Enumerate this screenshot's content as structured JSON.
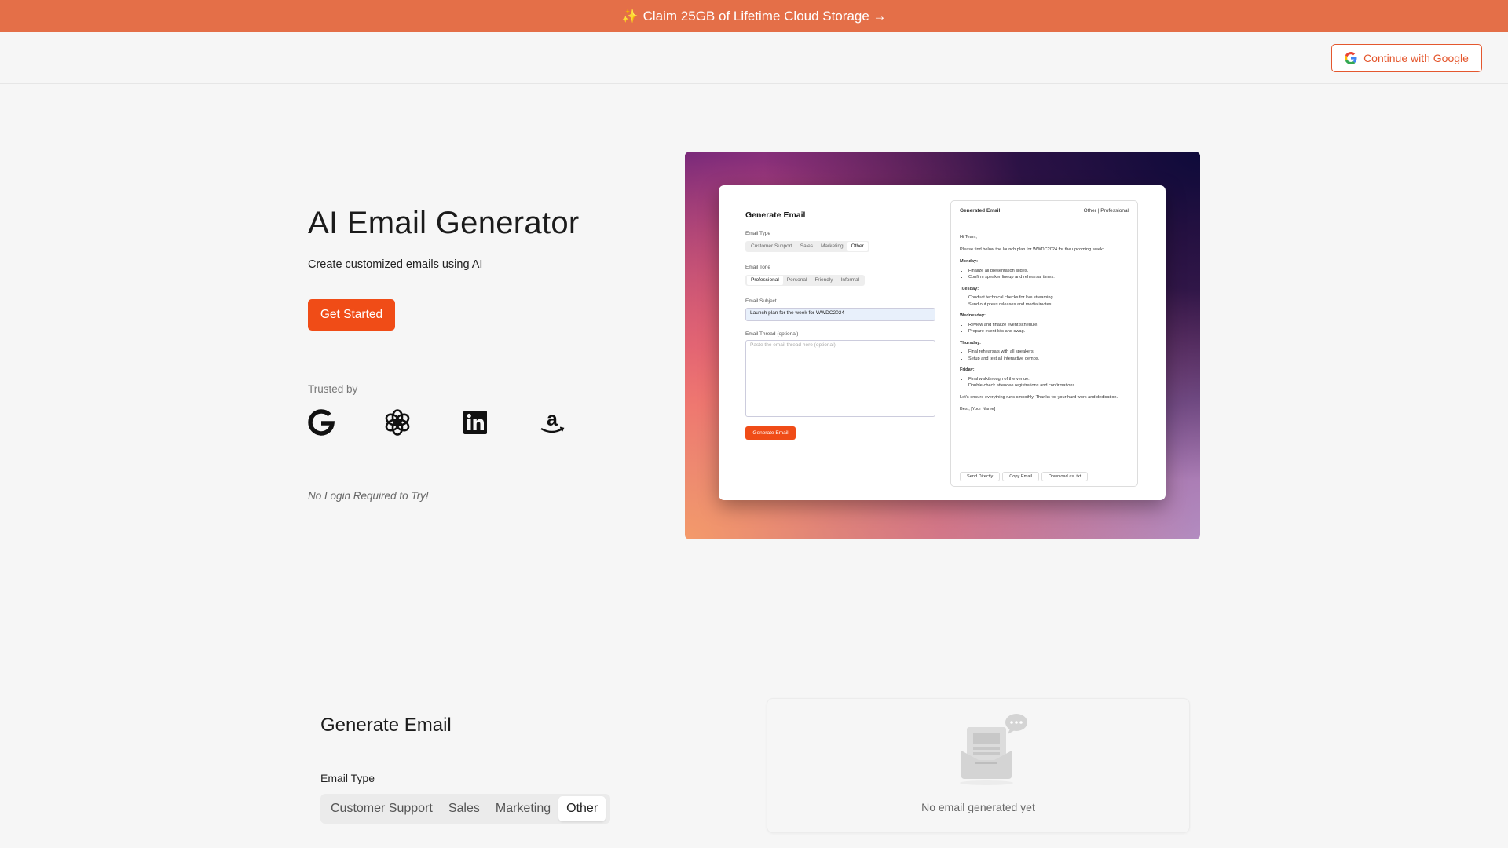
{
  "banner": {
    "text": "Claim 25GB of Lifetime Cloud Storage →",
    "icon": "sparkle-icon"
  },
  "header": {
    "google_button": "Continue with Google"
  },
  "hero": {
    "title": "AI Email Generator",
    "subtitle": "Create customized emails using AI",
    "cta": "Get Started",
    "trusted_by": "Trusted by",
    "logos": [
      "google-logo",
      "openai-logo",
      "linkedin-logo",
      "amazon-logo"
    ],
    "note": "No Login Required to Try!"
  },
  "preview": {
    "title": "Generate Email",
    "email_type_label": "Email Type",
    "email_types": [
      "Customer Support",
      "Sales",
      "Marketing",
      "Other"
    ],
    "email_tone_label": "Email Tone",
    "tones": [
      "Professional",
      "Personal",
      "Friendly",
      "Informal"
    ],
    "subject_label": "Email Subject",
    "subject_value": "Launch plan for the week for WWDC2024",
    "thread_label": "Email Thread (optional)",
    "thread_placeholder": "Paste the email thread here (optional)",
    "generate_button": "Generate Email",
    "output_title": "Generated Email",
    "output_meta": "Other | Professional",
    "greeting": "Hi Team,",
    "intro": "Please find below the launch plan for WWDC2024 for the upcoming week:",
    "days": [
      {
        "name": "Monday:",
        "items": [
          "Finalize all presentation slides.",
          "Confirm speaker lineup and rehearsal times."
        ]
      },
      {
        "name": "Tuesday:",
        "items": [
          "Conduct technical checks for live streaming.",
          "Send out press releases and media invites."
        ]
      },
      {
        "name": "Wednesday:",
        "items": [
          "Review and finalize event schedule.",
          "Prepare event kits and swag."
        ]
      },
      {
        "name": "Thursday:",
        "items": [
          "Final rehearsals with all speakers.",
          "Setup and test all interactive demos."
        ]
      },
      {
        "name": "Friday:",
        "items": [
          "Final walkthrough of the venue.",
          "Double-check attendee registrations and confirmations."
        ]
      }
    ],
    "closing": "Let's ensure everything runs smoothly. Thanks for your hard work and dedication.",
    "signoff": "Best, [Your Name]",
    "actions": [
      "Send Directly",
      "Copy Email",
      "Download as .txt"
    ]
  },
  "generator": {
    "title": "Generate Email",
    "email_type_label": "Email Type",
    "email_types": [
      "Customer Support",
      "Sales",
      "Marketing",
      "Other"
    ],
    "selected_type": "Other",
    "empty_state": "No email generated yet"
  },
  "colors": {
    "banner": "#e46f48",
    "accent": "#f04c17",
    "background": "#f6f6f6"
  }
}
